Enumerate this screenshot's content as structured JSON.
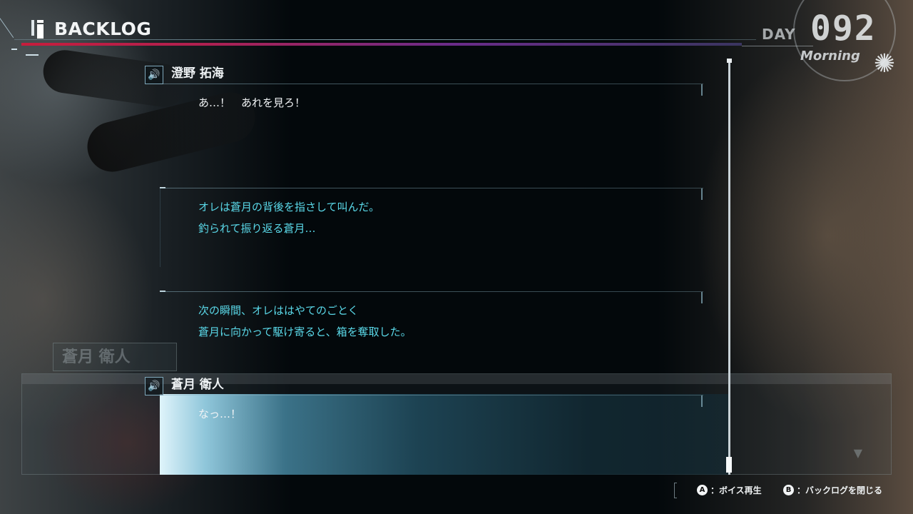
{
  "header": {
    "title": "BACKLOG"
  },
  "day_indicator": {
    "label": "DAY",
    "number": "092",
    "period": "Morning",
    "icon": "sun-icon"
  },
  "background_window": {
    "name": "蒼月 衛人"
  },
  "entries": [
    {
      "speaker": "澄野 拓海",
      "has_voice": true,
      "text_color": "#f0f3f5",
      "lines": [
        "あ…！　あれを見ろ！"
      ]
    },
    {
      "speaker": "",
      "has_voice": false,
      "text_color": "#5ad8e8",
      "lines": [
        "オレは蒼月の背後を指さして叫んだ。",
        "釣られて振り返る蒼月…"
      ]
    },
    {
      "speaker": "",
      "has_voice": false,
      "text_color": "#5ad8e8",
      "lines": [
        "次の瞬間、オレははやてのごとく",
        "蒼月に向かって駆け寄ると、箱を奪取した。"
      ]
    },
    {
      "speaker": "蒼月 衛人",
      "has_voice": true,
      "selected": true,
      "text_color": "#f0f3f5",
      "lines": [
        "なっ…！"
      ]
    }
  ],
  "footer": {
    "voice_button": {
      "key": "A",
      "label": "：ボイス再生"
    },
    "close_button": {
      "key": "B",
      "label": "：バックログを閉じる"
    }
  },
  "colors": {
    "accent_red": "#c71d3c",
    "accent_purple": "#6a2c8a",
    "narration_cyan": "#5ad8e8",
    "selection_highlight": "#8fc6da"
  }
}
